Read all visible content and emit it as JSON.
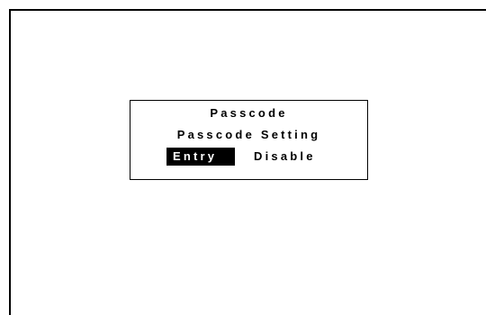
{
  "dialog": {
    "title": "Passcode",
    "setting_label": "Passcode Setting",
    "options": [
      {
        "label": "Entry",
        "selected": true
      },
      {
        "label": "Disable",
        "selected": false
      }
    ]
  },
  "colors": {
    "background": "#ffffff",
    "foreground": "#000000",
    "selected_bg": "#000000",
    "selected_fg": "#ffffff"
  }
}
